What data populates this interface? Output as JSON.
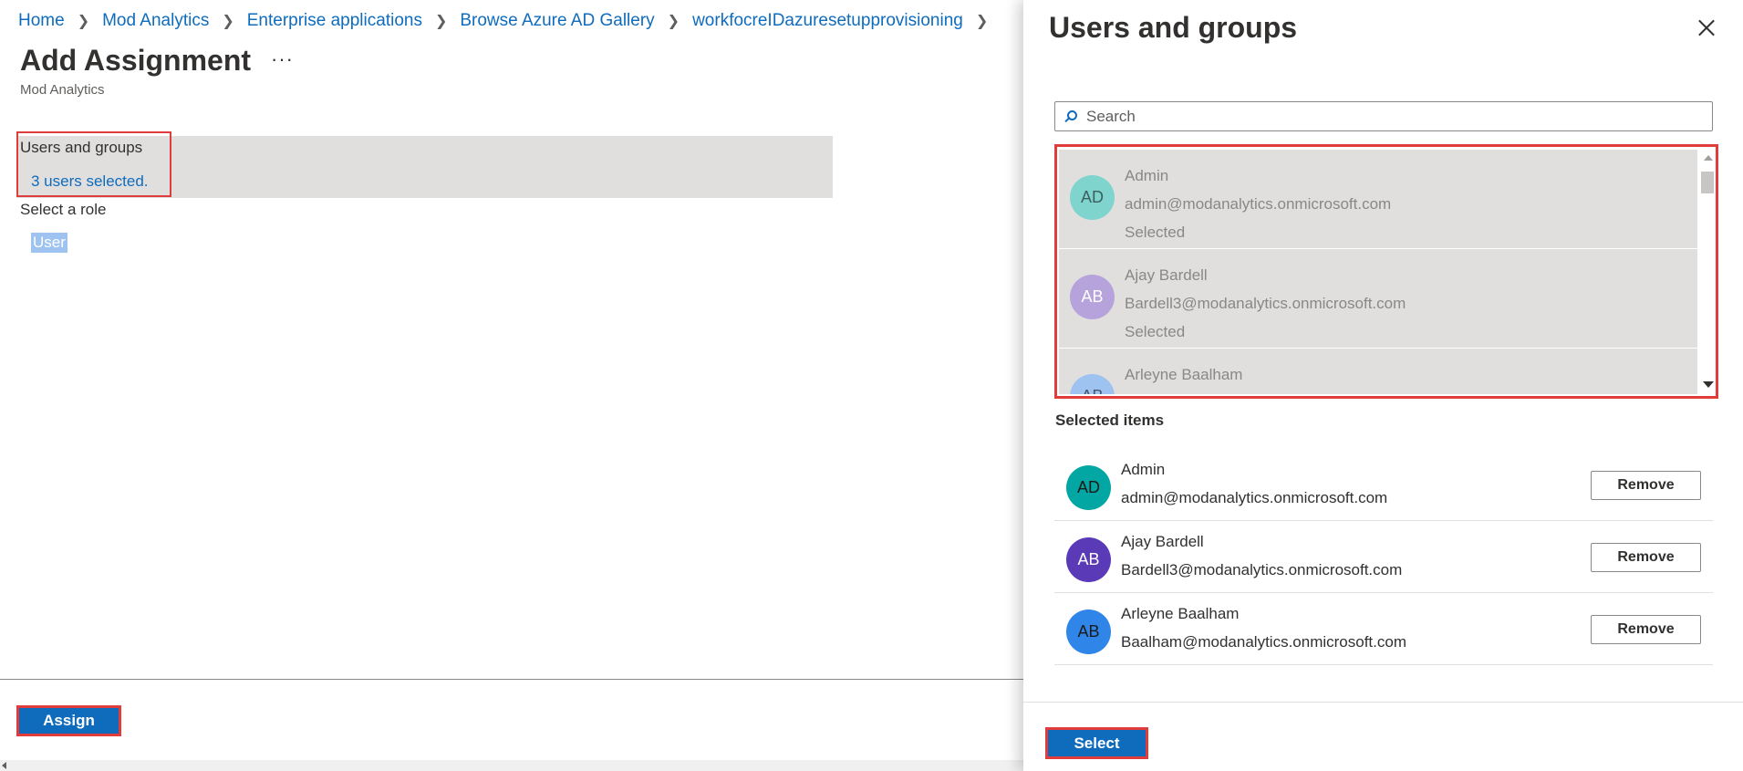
{
  "breadcrumb": [
    "Home",
    "Mod Analytics",
    "Enterprise applications",
    "Browse Azure AD Gallery",
    "workfocreIDazuresetupprovisioning"
  ],
  "page": {
    "title": "Add Assignment",
    "more_label": "···",
    "subtitle": "Mod Analytics"
  },
  "assignment": {
    "users_groups_label": "Users and groups",
    "users_selected_link": "3 users selected.",
    "role_label": "Select a role",
    "role_value": "User"
  },
  "footer": {
    "assign_label": "Assign"
  },
  "panel": {
    "title": "Users and groups",
    "search_placeholder": "Search",
    "list": [
      {
        "initials": "AD",
        "name": "Admin",
        "email": "admin@modanalytics.onmicrosoft.com",
        "status": "Selected",
        "avatar_color": "#7fd4ce"
      },
      {
        "initials": "AB",
        "name": "Ajay Bardell",
        "email": "Bardell3@modanalytics.onmicrosoft.com",
        "status": "Selected",
        "avatar_color": "#b6a3dc"
      },
      {
        "initials": "AB",
        "name": "Arleyne Baalham",
        "email": "",
        "status": "",
        "avatar_color": "#9fc3f0"
      }
    ],
    "selected_heading": "Selected items",
    "selected": [
      {
        "initials": "AD",
        "name": "Admin",
        "email": "admin@modanalytics.onmicrosoft.com",
        "avatar_color": "#02a6a2",
        "remove_label": "Remove"
      },
      {
        "initials": "AB",
        "name": "Ajay Bardell",
        "email": "Bardell3@modanalytics.onmicrosoft.com",
        "avatar_color": "#5a3ab7",
        "remove_label": "Remove"
      },
      {
        "initials": "AB",
        "name": "Arleyne Baalham",
        "email": "Baalham@modanalytics.onmicrosoft.com",
        "avatar_color": "#2f86e8",
        "remove_label": "Remove"
      }
    ],
    "select_label": "Select"
  },
  "colors": {
    "accent": "#0f6cbd",
    "highlight_border": "#e03c3c",
    "row_bg": "#e1dfdd"
  }
}
